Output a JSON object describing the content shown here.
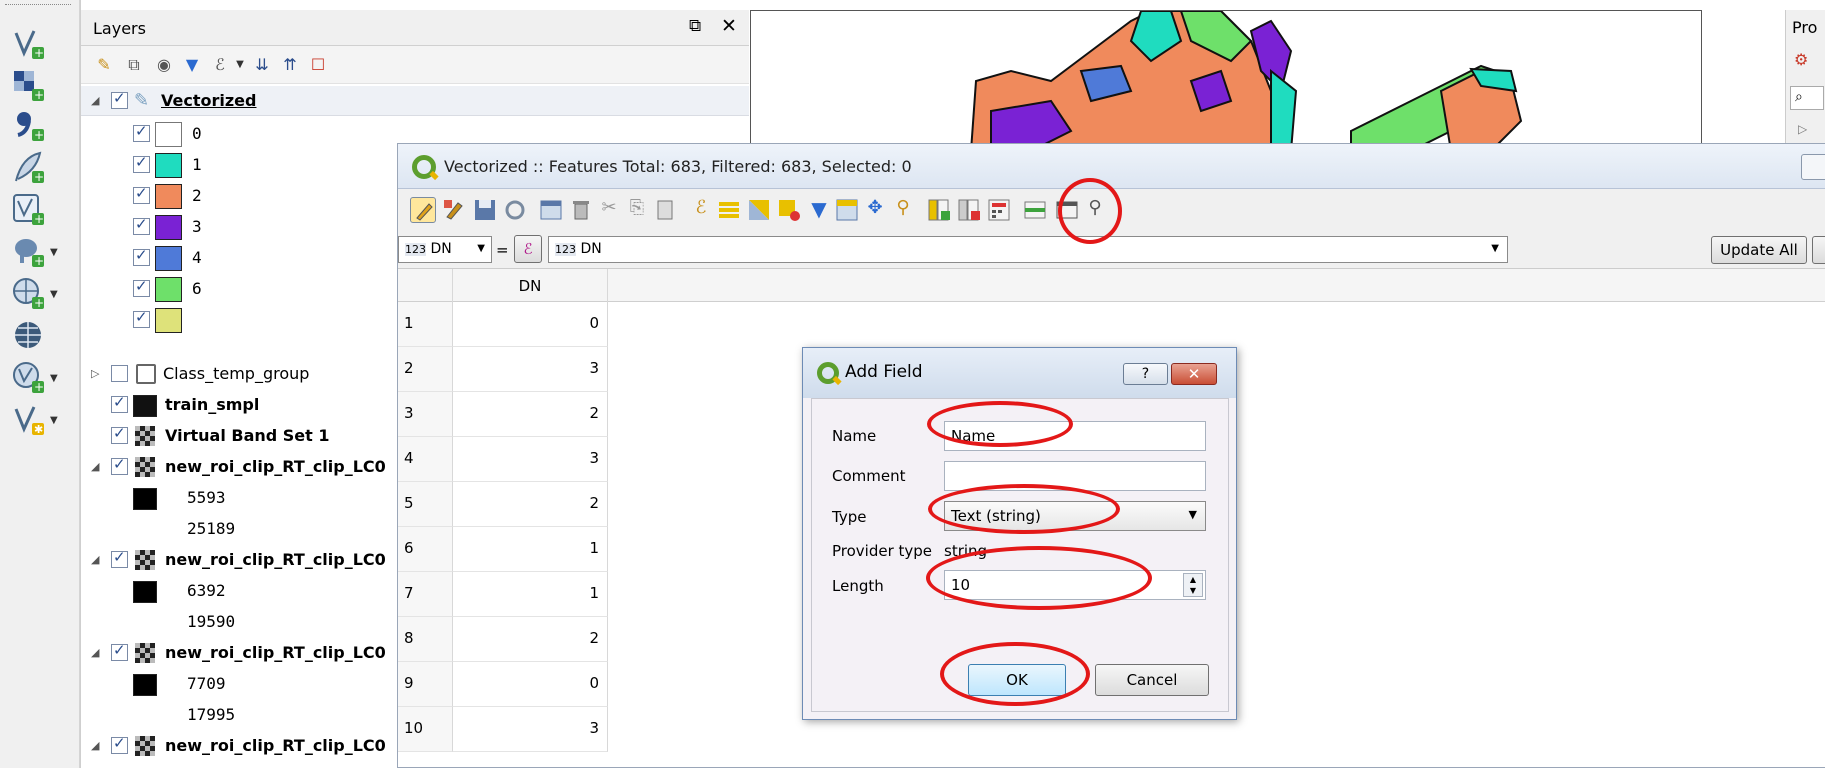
{
  "layers_panel": {
    "title": "Layers",
    "float_icon": "⧉",
    "close_icon": "✕",
    "tree": [
      {
        "label": "Vectorized",
        "kind": "vector-layer",
        "checked": true,
        "bold": true
      },
      {
        "label": "0",
        "kind": "class",
        "color": "#ffffff"
      },
      {
        "label": "1",
        "kind": "class",
        "color": "#1fdcbf"
      },
      {
        "label": "2",
        "kind": "class",
        "color": "#f08a5c"
      },
      {
        "label": "3",
        "kind": "class",
        "color": "#7a22d4"
      },
      {
        "label": "4",
        "kind": "class",
        "color": "#4f7ad8"
      },
      {
        "label": "6",
        "kind": "class",
        "color": "#6ee06a"
      },
      {
        "label": "",
        "kind": "class",
        "color": "#dee27a"
      },
      {
        "label": "Class_temp_group",
        "kind": "group",
        "checked": false
      },
      {
        "label": "train_smpl",
        "kind": "layer",
        "checked": true,
        "bold": true
      },
      {
        "label": "Virtual Band Set 1",
        "kind": "raster",
        "checked": true,
        "bold": true
      },
      {
        "label": "new_roi_clip_RT_clip_LC0",
        "kind": "raster",
        "checked": true,
        "bold": true
      },
      {
        "label": "5593",
        "kind": "legend",
        "color": "#000000"
      },
      {
        "label": "25189",
        "kind": "legend-text"
      },
      {
        "label": "new_roi_clip_RT_clip_LC0",
        "kind": "raster",
        "checked": true,
        "bold": true
      },
      {
        "label": "6392",
        "kind": "legend",
        "color": "#000000"
      },
      {
        "label": "19590",
        "kind": "legend-text"
      },
      {
        "label": "new_roi_clip_RT_clip_LC0",
        "kind": "raster",
        "checked": true,
        "bold": true
      },
      {
        "label": "7709",
        "kind": "legend",
        "color": "#000000"
      },
      {
        "label": "17995",
        "kind": "legend-text"
      },
      {
        "label": "new_roi_clip_RT_clip_LC0",
        "kind": "raster",
        "checked": true,
        "bold": true
      }
    ]
  },
  "right_panel": {
    "title": "Pro"
  },
  "attribute_table": {
    "title": "Vectorized :: Features Total: 683, Filtered: 683, Selected: 0",
    "field_select": "DN",
    "field_type_badge": "123",
    "operator": "=",
    "expression_icon": "ℰ",
    "value_field": "DN",
    "update_all_label": "Update All",
    "columns": [
      "DN"
    ],
    "rows": [
      {
        "id": "1",
        "dn": "0"
      },
      {
        "id": "2",
        "dn": "3"
      },
      {
        "id": "3",
        "dn": "2"
      },
      {
        "id": "4",
        "dn": "3"
      },
      {
        "id": "5",
        "dn": "2"
      },
      {
        "id": "6",
        "dn": "1"
      },
      {
        "id": "7",
        "dn": "1"
      },
      {
        "id": "8",
        "dn": "2"
      },
      {
        "id": "9",
        "dn": "0"
      },
      {
        "id": "10",
        "dn": "3"
      }
    ]
  },
  "add_field_dialog": {
    "title": "Add Field",
    "help_label": "?",
    "close_label": "✕",
    "name_label": "Name",
    "name_value": "Name",
    "comment_label": "Comment",
    "comment_value": "",
    "type_label": "Type",
    "type_value": "Text (string)",
    "provider_type_label": "Provider type",
    "provider_type_value": "string",
    "length_label": "Length",
    "length_value": "10",
    "ok_label": "OK",
    "cancel_label": "Cancel"
  },
  "colors": {
    "annotation": "#e31818",
    "class_1": "#1fdcbf",
    "class_2": "#f08a5c",
    "class_3": "#7a22d4",
    "class_4": "#4f7ad8",
    "class_6": "#6ee06a"
  }
}
